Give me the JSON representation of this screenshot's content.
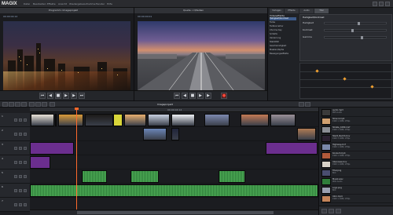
{
  "app": {
    "logo": "MAGIX",
    "menu": [
      "Datei",
      "Bearbeiten",
      "Effekte",
      "Ansicht",
      "Wiedergabe",
      "Aufnahme",
      "Fenster",
      "Hilfe"
    ]
  },
  "preview_left": {
    "title": "Programm: Imageprojekt",
    "timecode": "00:00:04:14"
  },
  "preview_right": {
    "title": "Quelle: c:\\Medien",
    "timecode": "00:00:00:01"
  },
  "effects": {
    "tabs": [
      "Vorlagen",
      "Effekte",
      "Audio",
      "Titel"
    ],
    "header": "Videoeffekte",
    "list": [
      "Helligkeit/Kontrast",
      "Farbe",
      "Farbkorrektur",
      "Chroma Key",
      "Schärfe",
      "Verzerrung",
      "Stabilität",
      "Geschwindigkeit",
      "Masken/Alpha",
      "Bewegungseffekte"
    ],
    "selected_index": 0,
    "param_title": "Helligkeit/Kontrast",
    "param_labels": [
      "Helligkeit",
      "Kontrast",
      "Gamma"
    ],
    "param_values": [
      0.55,
      0.45,
      0.6
    ]
  },
  "timeline": {
    "title": "Imageprojekt",
    "ruler_label": "00:00:04:14",
    "tracks": [
      "1",
      "2",
      "3",
      "4",
      "5",
      "6",
      "7"
    ],
    "playhead_pos": 0.16
  },
  "pool": {
    "items": [
      {
        "name": "audio.mp3",
        "desc": "MP3 Audio"
      },
      {
        "name": "Strand.mp4",
        "desc": "1920 x 1080, 25fps"
      },
      {
        "name": "Straße_1080.mxf",
        "desc": "1920 x 1080, 25fps"
      },
      {
        "name": "Stadt_Nacht.mov",
        "desc": "1920 x 1080, 25fps"
      },
      {
        "name": "Highway.mxf",
        "desc": "1920 x 1080, 25fps"
      },
      {
        "name": "Konzert.mp4",
        "desc": "1920 x 1080, 25fps"
      },
      {
        "name": "Interview.mov",
        "desc": "1920 x 1080, 25fps"
      },
      {
        "name": "Titel.png",
        "desc": "Bild"
      },
      {
        "name": "Musik.wav",
        "desc": "WAV Audio"
      },
      {
        "name": "Logo.png",
        "desc": "Bild"
      },
      {
        "name": "Intro.mp4",
        "desc": "1920 x 1080, 25fps"
      }
    ]
  }
}
